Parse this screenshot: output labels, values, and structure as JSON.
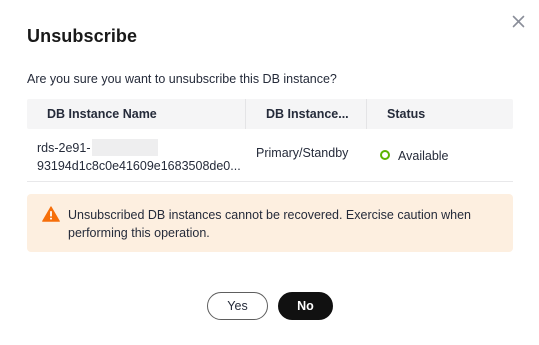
{
  "dialog": {
    "title": "Unsubscribe",
    "question": "Are you sure you want to unsubscribe this DB instance?",
    "close_icon": "close-icon"
  },
  "table": {
    "headers": [
      "DB Instance Name",
      "DB Instance...",
      "Status"
    ],
    "rows": [
      {
        "name_line1": "rds-2e91-",
        "name_line2": "93194d1c8c0e41609e1683508de0...",
        "instance_type": "Primary/Standby",
        "status": "Available",
        "status_color": "#5cb300"
      }
    ]
  },
  "alert": {
    "icon": "warning-icon",
    "color": "#fdefe0",
    "icon_color": "#f66f0a",
    "text": "Unsubscribed DB instances cannot be recovered. Exercise caution when performing this operation."
  },
  "buttons": {
    "yes": "Yes",
    "no": "No"
  }
}
